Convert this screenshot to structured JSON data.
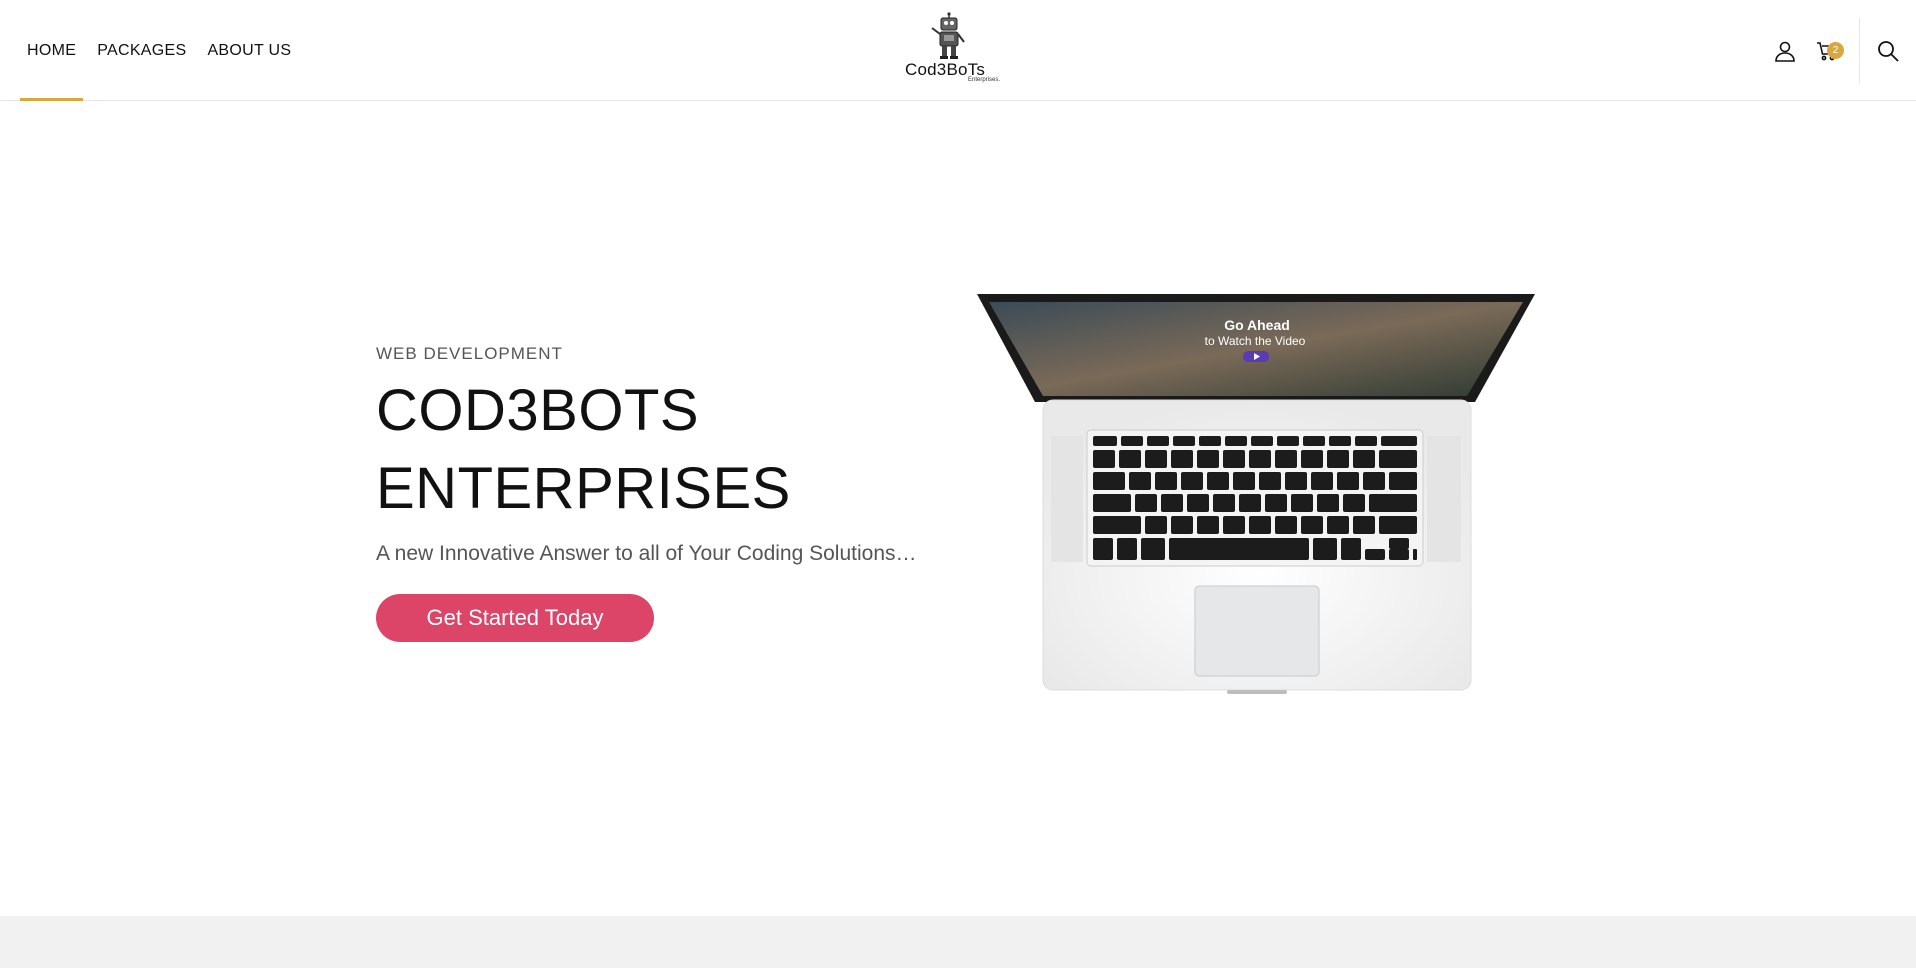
{
  "nav": {
    "items": [
      {
        "label": "HOME",
        "active": true
      },
      {
        "label": "PACKAGES",
        "active": false
      },
      {
        "label": "ABOUT US",
        "active": false
      }
    ]
  },
  "logo": {
    "name": "Cod3BoTs",
    "sub": "Enterprises.",
    "icon": "robot-icon"
  },
  "header_icons": {
    "account": "user-icon",
    "cart": "cart-icon",
    "cart_count": "2",
    "search": "search-icon"
  },
  "hero": {
    "eyebrow": "WEB DEVELOPMENT",
    "title_line1": "COD3BOTS",
    "title_line2": "ENTERPRISES",
    "subtitle": "A new Innovative Answer to all of Your Coding Solutions…",
    "cta_label": "Get Started Today",
    "screen_line1": "Go Ahead",
    "screen_line2": "to Watch the Video"
  },
  "colors": {
    "accent": "#d8a73f",
    "cta": "#dc4468",
    "band": "#f1f1f1"
  }
}
